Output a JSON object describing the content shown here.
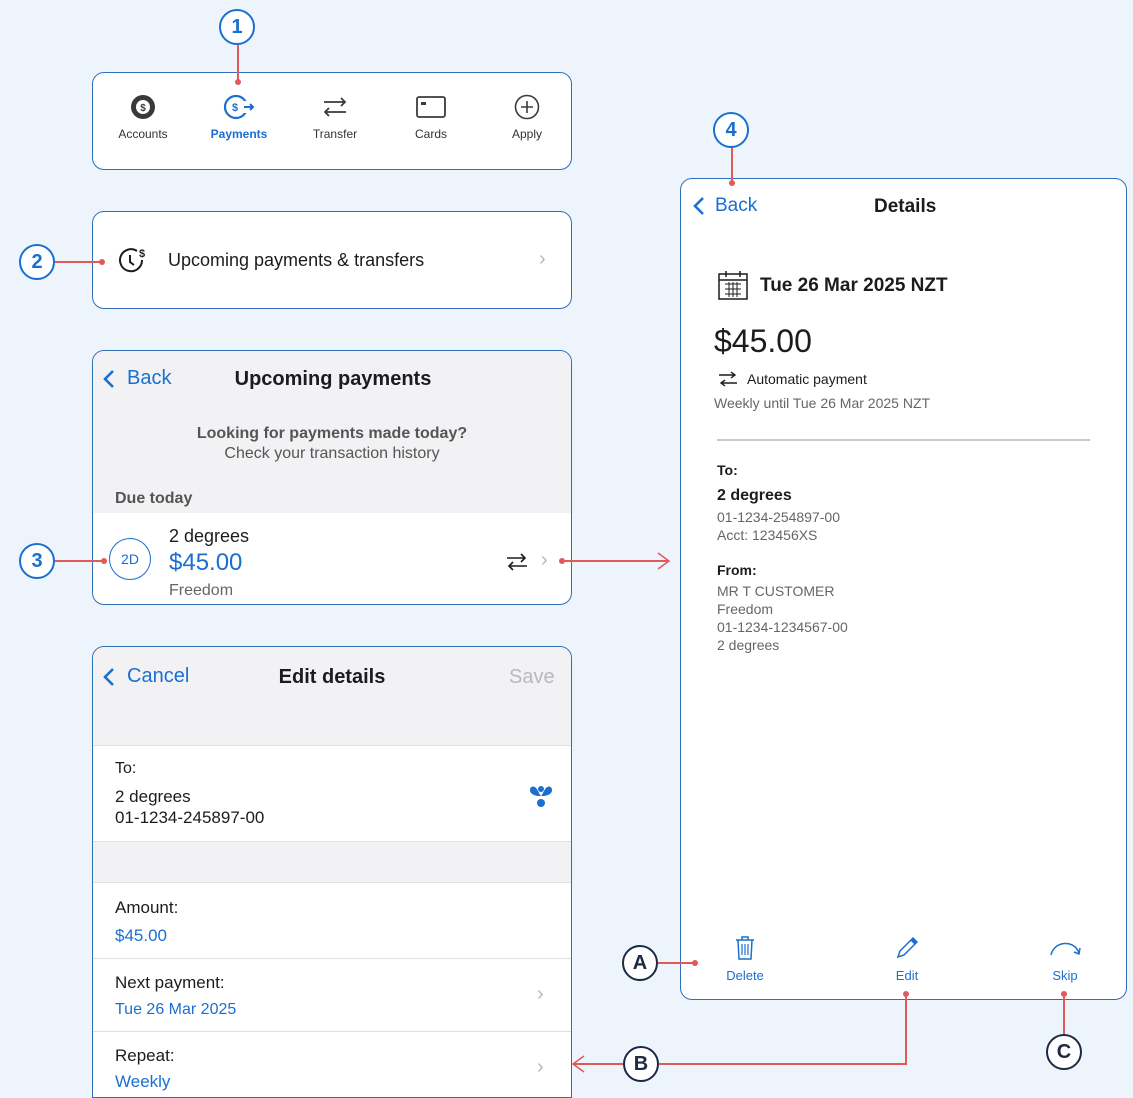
{
  "callouts": {
    "c1": "1",
    "c2": "2",
    "c3": "3",
    "c4": "4",
    "cA": "A",
    "cB": "B",
    "cC": "C"
  },
  "tabbar": {
    "tabs": [
      {
        "label": "Accounts"
      },
      {
        "label": "Payments"
      },
      {
        "label": "Transfer"
      },
      {
        "label": "Cards"
      },
      {
        "label": "Apply"
      }
    ]
  },
  "upcoming_row": {
    "label": "Upcoming payments & transfers"
  },
  "upcoming": {
    "back": "Back",
    "title": "Upcoming payments",
    "hint_line1": "Looking for payments made today?",
    "hint_line2": "Check your transaction history",
    "section": "Due today",
    "item": {
      "initials": "2D",
      "name": "2 degrees",
      "amount": "$45.00",
      "account": "Freedom"
    }
  },
  "edit": {
    "cancel": "Cancel",
    "title": "Edit details",
    "save": "Save",
    "to_label": "To:",
    "to_name": "2 degrees",
    "to_account": "01-1234-245897-00",
    "amount_label": "Amount:",
    "amount_value": "$45.00",
    "next_label": "Next payment:",
    "next_value": "Tue 26 Mar 2025",
    "repeat_label": "Repeat:",
    "repeat_value": "Weekly"
  },
  "details": {
    "back": "Back",
    "title": "Details",
    "date": "Tue 26 Mar 2025 NZT",
    "amount": "$45.00",
    "type": "Automatic payment",
    "frequency": "Weekly until Tue 26 Mar 2025 NZT",
    "to_label": "To:",
    "to_name": "2 degrees",
    "to_account": "01-1234-254897-00",
    "to_ref": "Acct: 123456XS",
    "from_label": "From:",
    "from_line1": "MR T CUSTOMER",
    "from_line2": "Freedom",
    "from_line3": "01-1234-1234567-00",
    "from_line4": "2 degrees",
    "actions": {
      "delete": "Delete",
      "edit": "Edit",
      "skip": "Skip"
    }
  },
  "colors": {
    "accent": "#1a6fd1",
    "connector": "#e05a5a",
    "panel_border": "#2f6fb9"
  }
}
